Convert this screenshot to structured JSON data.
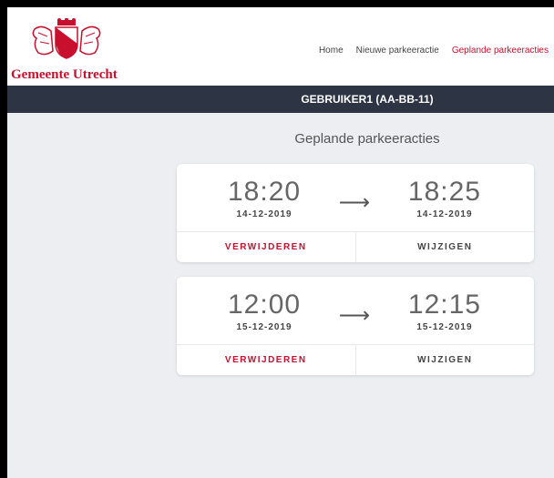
{
  "brand": {
    "name": "Gemeente Utrecht",
    "color": "#c8102e"
  },
  "nav": {
    "items": [
      {
        "label": "Home",
        "active": false
      },
      {
        "label": "Nieuwe parkeeractie",
        "active": false
      },
      {
        "label": "Geplande parkeeracties",
        "active": true
      }
    ]
  },
  "userbar": {
    "label": "GEBRUIKER1 (AA-BB-11)"
  },
  "page": {
    "title": "Geplande parkeeracties"
  },
  "actions": [
    {
      "start_time": "18:20",
      "start_date": "14-12-2019",
      "end_time": "18:25",
      "end_date": "14-12-2019",
      "delete_label": "VERWIJDEREN",
      "edit_label": "WIJZIGEN"
    },
    {
      "start_time": "12:00",
      "start_date": "15-12-2019",
      "end_time": "12:15",
      "end_date": "15-12-2019",
      "delete_label": "VERWIJDEREN",
      "edit_label": "WIJZIGEN"
    }
  ],
  "icons": {
    "arrow": "right-arrow-icon",
    "logo": "utrecht-coat-of-arms"
  }
}
